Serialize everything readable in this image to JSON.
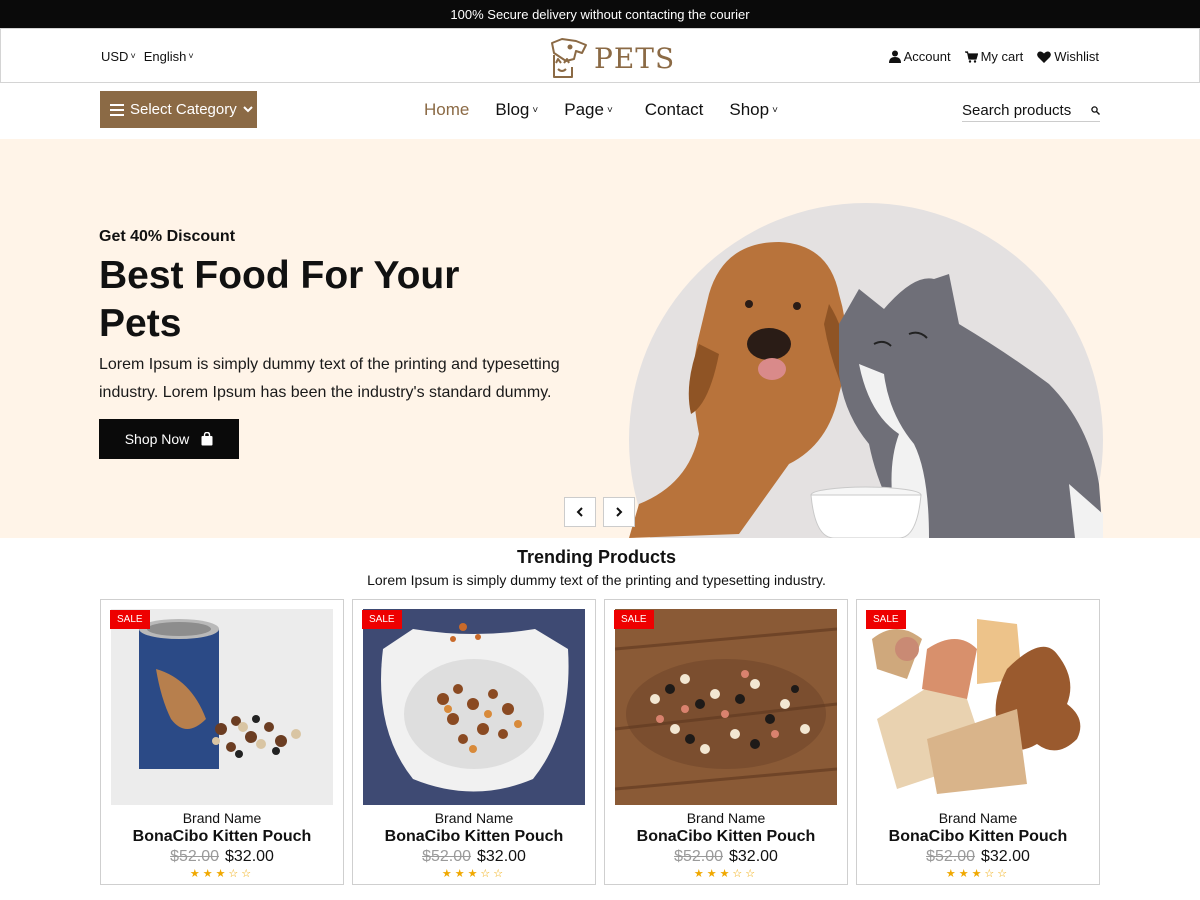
{
  "announcement": "100% Secure delivery without contacting the courier",
  "header": {
    "currency": "USD",
    "language": "English",
    "logo_text": "PETS",
    "links": [
      {
        "label": "Account",
        "icon": "user-icon"
      },
      {
        "label": "My cart",
        "icon": "cart-icon"
      },
      {
        "label": "Wishlist",
        "icon": "heart-icon"
      }
    ]
  },
  "nav": {
    "category_label": "Select Category",
    "items": [
      {
        "label": "Home",
        "active": true,
        "dropdown": false
      },
      {
        "label": "Blog",
        "active": false,
        "dropdown": true
      },
      {
        "label": "Page",
        "active": false,
        "dropdown": true
      },
      {
        "label": "Contact",
        "active": false,
        "dropdown": false
      },
      {
        "label": "Shop",
        "active": false,
        "dropdown": true
      }
    ],
    "search_placeholder": "Search products"
  },
  "hero": {
    "eyebrow": "Get 40% Discount",
    "title": "Best Food For Your Pets",
    "description": "Lorem Ipsum is simply dummy text of the printing and typesetting industry. Lorem Ipsum has been the industry's standard dummy.",
    "button_label": "Shop Now",
    "prev_icon": "chevron-left-icon",
    "next_icon": "chevron-right-icon"
  },
  "trending": {
    "title": "Trending Products",
    "subtitle": "Lorem Ipsum is simply dummy text of the printing and typesetting industry.",
    "products": [
      {
        "badge": "SALE",
        "brand": "Brand Name",
        "name": "BonaCibo Kitten Pouch",
        "old_price": "$52.00",
        "price": "$32.00",
        "rating": 3,
        "max_rating": 5
      },
      {
        "badge": "SALE",
        "brand": "Brand Name",
        "name": "BonaCibo Kitten Pouch",
        "old_price": "$52.00",
        "price": "$32.00",
        "rating": 3,
        "max_rating": 5
      },
      {
        "badge": "SALE",
        "brand": "Brand Name",
        "name": "BonaCibo Kitten Pouch",
        "old_price": "$52.00",
        "price": "$32.00",
        "rating": 3,
        "max_rating": 5
      },
      {
        "badge": "SALE",
        "brand": "Brand Name",
        "name": "BonaCibo Kitten Pouch",
        "old_price": "$52.00",
        "price": "$32.00",
        "rating": 3,
        "max_rating": 5
      }
    ]
  },
  "colors": {
    "brand": "#8b6a45",
    "hero_bg": "#fff4e8",
    "sale": "#ee0000",
    "star": "#f0a800"
  }
}
